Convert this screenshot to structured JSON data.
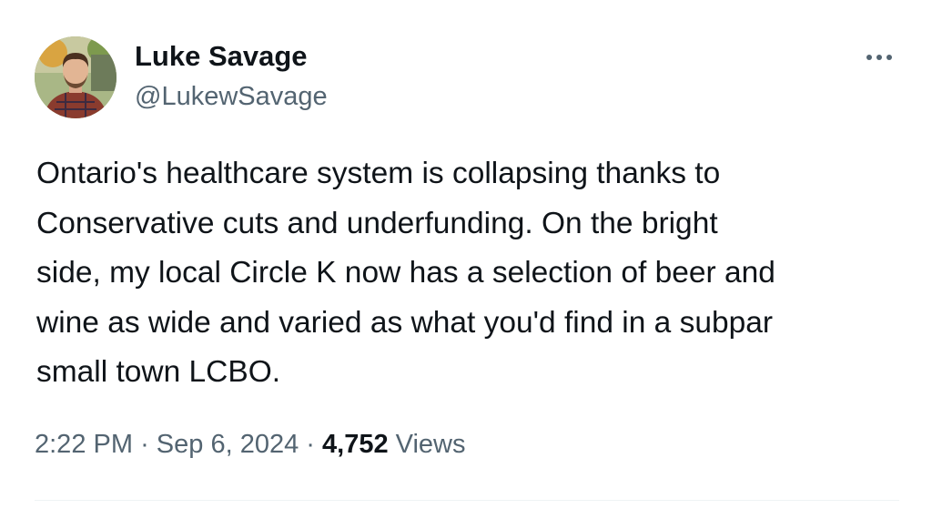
{
  "author": {
    "name": "Luke Savage",
    "handle": "@LukewSavage"
  },
  "tweet": {
    "text": "Ontario's healthcare system is collapsing thanks to\nConservative cuts and underfunding. On the bright\nside, my local Circle K now has a selection of beer and\nwine as wide and varied as what you'd find in a subpar\nsmall town LCBO.",
    "time": "2:22 PM",
    "separator": "·",
    "date": "Sep 6, 2024",
    "views_count": "4,752",
    "views_label": "Views"
  },
  "icons": {
    "more": "more-horizontal-icon"
  },
  "colors": {
    "text_primary": "#0f1419",
    "text_secondary": "#536471",
    "divider": "#eff3f4"
  }
}
